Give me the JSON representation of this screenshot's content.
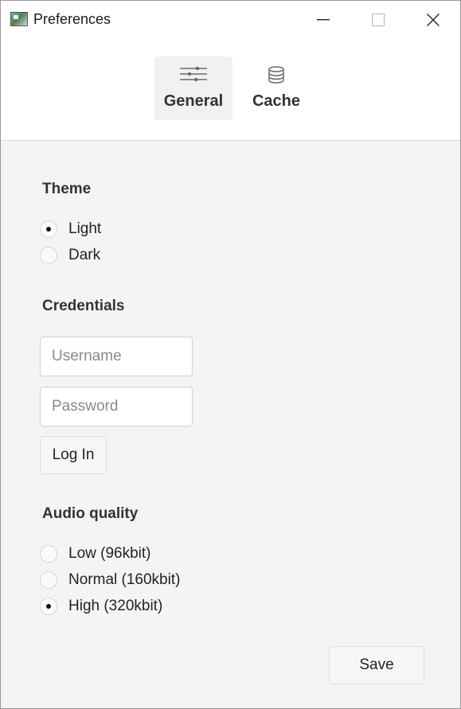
{
  "window": {
    "title": "Preferences"
  },
  "tabs": [
    {
      "label": "General",
      "icon": "sliders-icon",
      "active": true
    },
    {
      "label": "Cache",
      "icon": "database-icon",
      "active": false
    }
  ],
  "theme": {
    "title": "Theme",
    "options": [
      {
        "label": "Light",
        "checked": true
      },
      {
        "label": "Dark",
        "checked": false
      }
    ]
  },
  "credentials": {
    "title": "Credentials",
    "username_placeholder": "Username",
    "username_value": "",
    "password_placeholder": "Password",
    "password_value": "",
    "login_label": "Log In"
  },
  "audio": {
    "title": "Audio quality",
    "options": [
      {
        "label": "Low (96kbit)",
        "checked": false
      },
      {
        "label": "Normal (160kbit)",
        "checked": false
      },
      {
        "label": "High (320kbit)",
        "checked": true
      }
    ]
  },
  "footer": {
    "save_label": "Save"
  },
  "colors": {
    "content_bg": "#f3f4f6",
    "active_tab_bg": "#f0f1f2",
    "header_bg": "#ffffff"
  }
}
